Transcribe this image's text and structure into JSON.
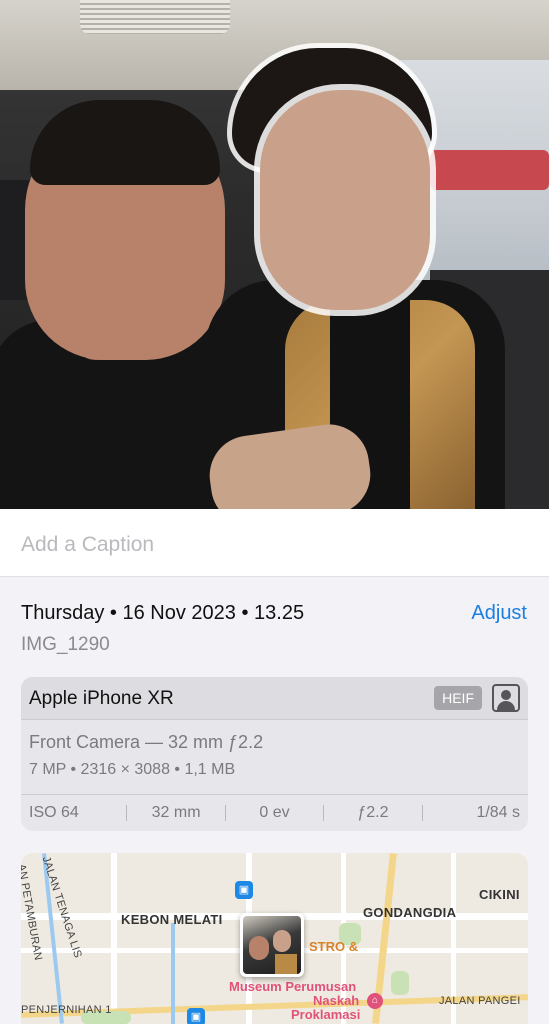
{
  "caption": {
    "placeholder": "Add a Caption"
  },
  "info": {
    "date": "Thursday • 16 Nov 2023 • 13.25",
    "adjust_label": "Adjust",
    "filename": "IMG_1290"
  },
  "camera": {
    "device": "Apple iPhone XR",
    "format_badge": "HEIF",
    "lens": "Front Camera — 32 mm ƒ2.2",
    "specs": "7 MP  •  2316 × 3088  •  1,1 MB",
    "exif": {
      "iso": "ISO 64",
      "focal_length": "32 mm",
      "exposure_value": "0 ev",
      "aperture": "ƒ2.2",
      "shutter": "1/84 s"
    }
  },
  "map": {
    "labels": {
      "kebon_melati": "KEBON MELATI",
      "gondangdia": "GONDANGDIA",
      "cikini": "CIKINI",
      "jalan_tenaga": "JALAN TENAGA LIS",
      "jalan_pejambon": "AN PETAMBURAN",
      "jalan_penjernihan": "PENJERNIHAN 1",
      "jalan_pangeran": "JALAN PANGEI",
      "poi_bistro": "STRO &",
      "poi_museum_1": "Museum Perumusan",
      "poi_museum_2": "Naskah",
      "poi_museum_3": "Proklamasi"
    },
    "colors": {
      "transit": "#1e88e5",
      "museum": "#e0527b",
      "food": "#d9822b"
    }
  },
  "icons": {
    "portrait": "portrait-mode-icon",
    "transit": "bus-stop-icon",
    "museum": "museum-icon"
  }
}
